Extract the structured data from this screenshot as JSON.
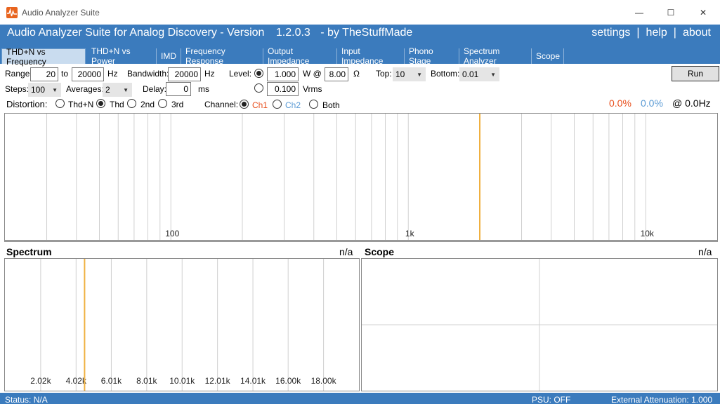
{
  "window": {
    "title": "Audio Analyzer Suite",
    "minimize": "—",
    "maximize": "☐",
    "close": "✕"
  },
  "header": {
    "title_prefix": "Audio Analyzer Suite for Analog Discovery - Version",
    "version": "1.2.0.3",
    "title_suffix": "- by TheStuffMade",
    "nav": [
      "settings",
      "|",
      "help",
      "|",
      "about"
    ]
  },
  "tabs": [
    {
      "label": "THD+N vs Frequency",
      "active": true
    },
    {
      "label": "THD+N vs Power",
      "active": false
    },
    {
      "label": "IMD",
      "active": false
    },
    {
      "label": "Frequency Response",
      "active": false
    },
    {
      "label": "Output Impedance",
      "active": false
    },
    {
      "label": "Input Impedance",
      "active": false
    },
    {
      "label": "Phono Stage",
      "active": false
    },
    {
      "label": "Spectrum Analyzer",
      "active": false
    },
    {
      "label": "Scope",
      "active": false
    }
  ],
  "controls": {
    "range_label": "Range:",
    "range_from": "20",
    "to_label": "to",
    "range_to": "20000",
    "hz_label": "Hz",
    "bandwidth_label": "Bandwidth:",
    "bandwidth": "20000",
    "bandwidth_unit": "Hz",
    "level_label": "Level:",
    "level_w": "1.000",
    "w_at_label": "W @",
    "load": "8.00",
    "ohm_label": "Ω",
    "level_vrms": "0.100",
    "vrms_label": "Vrms",
    "top_label": "Top:",
    "top_value": "10",
    "bottom_label": "Bottom:",
    "bottom_value": "0.01",
    "steps_label": "Steps:",
    "steps_value": "100",
    "averages_label": "Averages:",
    "averages_value": "2",
    "delay_label": "Delay:",
    "delay_value": "0",
    "delay_unit": "ms",
    "run_label": "Run",
    "distortion_label": "Distortion:",
    "dist_options": [
      "Thd+N",
      "Thd",
      "2nd",
      "3rd"
    ],
    "dist_selected": 1,
    "channel_label": "Channel:",
    "channel_options": [
      "Ch1",
      "Ch2",
      "Both"
    ],
    "channel_selected": 0,
    "level_selected": 0
  },
  "readouts": {
    "ch1": "0.0%",
    "ch2": "0.0%",
    "freq": "@ 0.0Hz"
  },
  "colors": {
    "accent": "#3b7bbd",
    "ch1": "#e8501e",
    "ch2": "#5b9bd5",
    "marker": "#f0b040",
    "grid": "#d0d0d0"
  },
  "spectrum": {
    "title": "Spectrum",
    "value": "n/a"
  },
  "scope": {
    "title": "Scope",
    "value": "n/a"
  },
  "status": {
    "status": "Status: N/A",
    "psu": "PSU: OFF",
    "attenuation": "External Attenuation: 1.000"
  },
  "chart_data": [
    {
      "type": "line",
      "name": "thdn_vs_frequency",
      "x_scale": "log",
      "xlim": [
        20,
        20000
      ],
      "x_tick_labels": [
        "100",
        "1k",
        "10k"
      ],
      "x_ticks": [
        100,
        1000,
        10000
      ],
      "marker_x": 2000,
      "series": []
    },
    {
      "type": "line",
      "name": "spectrum",
      "xlim": [
        0,
        20000
      ],
      "x_tick_labels": [
        "2.02k",
        "4.02k",
        "6.01k",
        "8.01k",
        "10.01k",
        "12.01k",
        "14.01k",
        "16.00k",
        "18.00k"
      ],
      "x_ticks": [
        2020,
        4020,
        6010,
        8010,
        10010,
        12010,
        14010,
        16000,
        18000
      ],
      "marker_x": 4500,
      "series": []
    },
    {
      "type": "line",
      "name": "scope",
      "series": []
    }
  ]
}
